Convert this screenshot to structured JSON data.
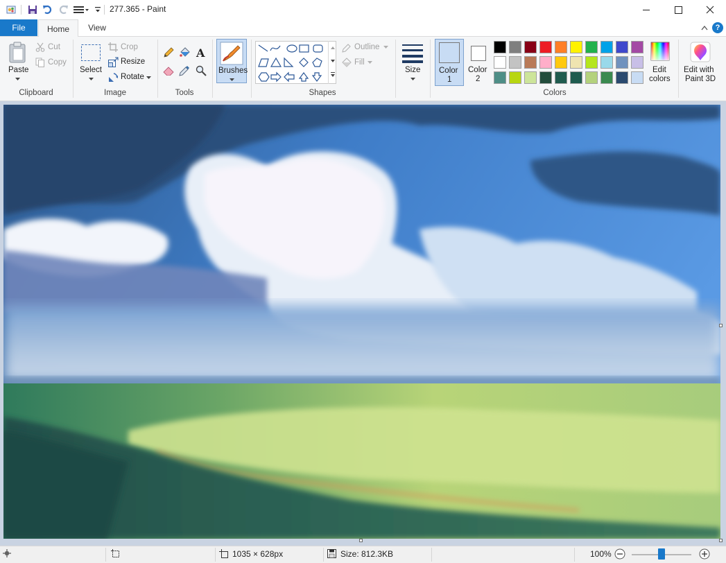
{
  "window": {
    "title": "277.365 - Paint"
  },
  "tabs": {
    "file": "File",
    "home": "Home",
    "view": "View"
  },
  "clipboard": {
    "paste": "Paste",
    "cut": "Cut",
    "copy": "Copy",
    "label": "Clipboard"
  },
  "image": {
    "select": "Select",
    "crop": "Crop",
    "resize": "Resize",
    "rotate": "Rotate",
    "label": "Image"
  },
  "tools": {
    "label": "Tools"
  },
  "brushes": {
    "label": "Brushes"
  },
  "shapes": {
    "outline": "Outline",
    "fill": "Fill",
    "label": "Shapes"
  },
  "size": {
    "label": "Size"
  },
  "colors": {
    "color1_line1": "Color",
    "color1_line2": "1",
    "color2_line1": "Color",
    "color2_line2": "2",
    "edit_line1": "Edit",
    "edit_line2": "colors",
    "label": "Colors",
    "color1_value": "#c8dcf4",
    "color2_value": "#ffffff",
    "palette": [
      [
        "#000000",
        "#7f7f7f",
        "#880015",
        "#ed1c24",
        "#ff7f27",
        "#fff200",
        "#22b14c",
        "#00a2e8",
        "#3f48cc",
        "#a349a4"
      ],
      [
        "#ffffff",
        "#c3c3c3",
        "#b97a57",
        "#ffaec9",
        "#ffc90e",
        "#efe4b0",
        "#b5e61d",
        "#99d9ea",
        "#7092be",
        "#c8bfe7"
      ],
      [
        "#4e8e86",
        "#b8d610",
        "#cde59a",
        "#234c3c",
        "#1f5b4e",
        "#1f5b4e",
        "#b4d27c",
        "#3b8a4f",
        "#2b4a6f",
        "#c8dcf4"
      ]
    ]
  },
  "paint3d": {
    "line1": "Edit with",
    "line2": "Paint 3D"
  },
  "status": {
    "dimensions": "1035 × 628px",
    "size": "Size: 812.3KB",
    "zoom": "100%"
  }
}
